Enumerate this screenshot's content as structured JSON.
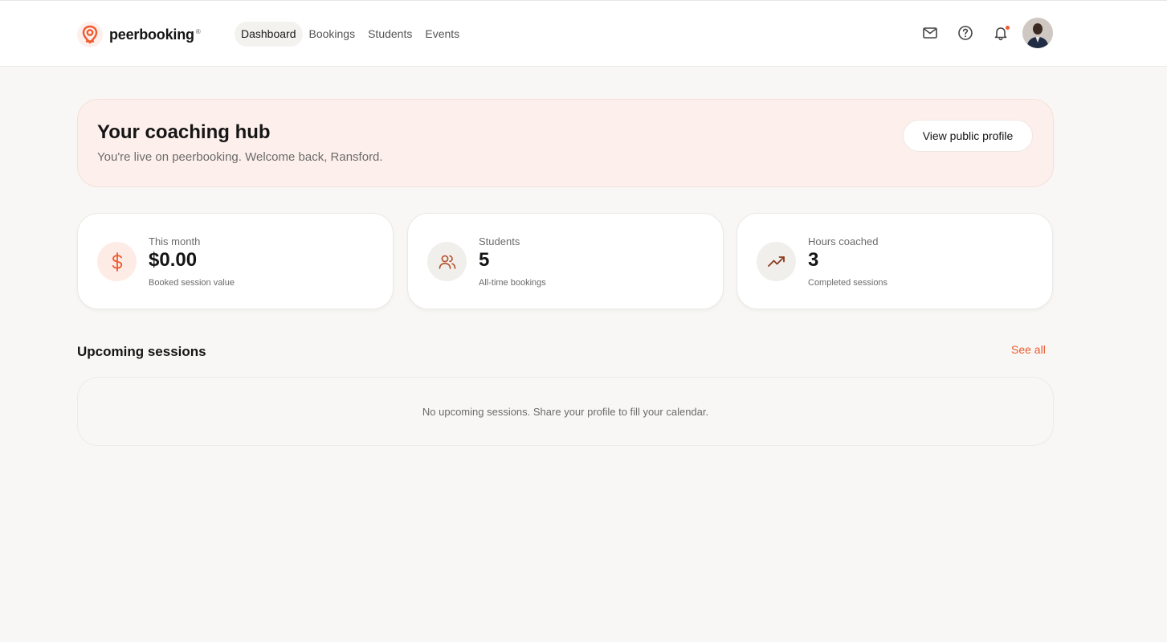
{
  "brand": {
    "name": "peerbooking",
    "registered": "®",
    "accent_color": "#ef5a2e"
  },
  "nav": {
    "items": [
      {
        "label": "Dashboard",
        "active": true
      },
      {
        "label": "Bookings",
        "active": false
      },
      {
        "label": "Students",
        "active": false
      },
      {
        "label": "Events",
        "active": false
      }
    ]
  },
  "header_icons": [
    "mail-icon",
    "help-icon",
    "bell-icon",
    "avatar"
  ],
  "hero": {
    "title": "Your coaching hub",
    "subtitle": "You're live on peerbooking. Welcome back, Ransford.",
    "button_label": "View public profile"
  },
  "stats": [
    {
      "icon": "dollar-icon",
      "label": "This month",
      "value": "$0.00",
      "note": "Booked session value"
    },
    {
      "icon": "users-icon",
      "label": "Students",
      "value": "5",
      "note": "All-time bookings"
    },
    {
      "icon": "trending-up-icon",
      "label": "Hours coached",
      "value": "3",
      "note": "Completed sessions"
    }
  ],
  "upcoming": {
    "title": "Upcoming sessions",
    "see_all_label": "See all",
    "empty_message": "No upcoming sessions. Share your profile to fill your calendar."
  }
}
